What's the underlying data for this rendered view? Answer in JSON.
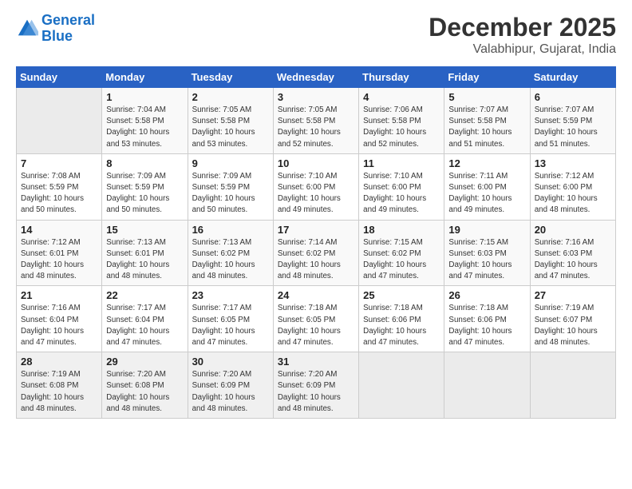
{
  "logo": {
    "text_general": "General",
    "text_blue": "Blue"
  },
  "header": {
    "month_year": "December 2025",
    "location": "Valabhipur, Gujarat, India"
  },
  "weekdays": [
    "Sunday",
    "Monday",
    "Tuesday",
    "Wednesday",
    "Thursday",
    "Friday",
    "Saturday"
  ],
  "weeks": [
    [
      {
        "day": "",
        "info": ""
      },
      {
        "day": "1",
        "info": "Sunrise: 7:04 AM\nSunset: 5:58 PM\nDaylight: 10 hours\nand 53 minutes."
      },
      {
        "day": "2",
        "info": "Sunrise: 7:05 AM\nSunset: 5:58 PM\nDaylight: 10 hours\nand 53 minutes."
      },
      {
        "day": "3",
        "info": "Sunrise: 7:05 AM\nSunset: 5:58 PM\nDaylight: 10 hours\nand 52 minutes."
      },
      {
        "day": "4",
        "info": "Sunrise: 7:06 AM\nSunset: 5:58 PM\nDaylight: 10 hours\nand 52 minutes."
      },
      {
        "day": "5",
        "info": "Sunrise: 7:07 AM\nSunset: 5:58 PM\nDaylight: 10 hours\nand 51 minutes."
      },
      {
        "day": "6",
        "info": "Sunrise: 7:07 AM\nSunset: 5:59 PM\nDaylight: 10 hours\nand 51 minutes."
      }
    ],
    [
      {
        "day": "7",
        "info": "Sunrise: 7:08 AM\nSunset: 5:59 PM\nDaylight: 10 hours\nand 50 minutes."
      },
      {
        "day": "8",
        "info": "Sunrise: 7:09 AM\nSunset: 5:59 PM\nDaylight: 10 hours\nand 50 minutes."
      },
      {
        "day": "9",
        "info": "Sunrise: 7:09 AM\nSunset: 5:59 PM\nDaylight: 10 hours\nand 50 minutes."
      },
      {
        "day": "10",
        "info": "Sunrise: 7:10 AM\nSunset: 6:00 PM\nDaylight: 10 hours\nand 49 minutes."
      },
      {
        "day": "11",
        "info": "Sunrise: 7:10 AM\nSunset: 6:00 PM\nDaylight: 10 hours\nand 49 minutes."
      },
      {
        "day": "12",
        "info": "Sunrise: 7:11 AM\nSunset: 6:00 PM\nDaylight: 10 hours\nand 49 minutes."
      },
      {
        "day": "13",
        "info": "Sunrise: 7:12 AM\nSunset: 6:00 PM\nDaylight: 10 hours\nand 48 minutes."
      }
    ],
    [
      {
        "day": "14",
        "info": "Sunrise: 7:12 AM\nSunset: 6:01 PM\nDaylight: 10 hours\nand 48 minutes."
      },
      {
        "day": "15",
        "info": "Sunrise: 7:13 AM\nSunset: 6:01 PM\nDaylight: 10 hours\nand 48 minutes."
      },
      {
        "day": "16",
        "info": "Sunrise: 7:13 AM\nSunset: 6:02 PM\nDaylight: 10 hours\nand 48 minutes."
      },
      {
        "day": "17",
        "info": "Sunrise: 7:14 AM\nSunset: 6:02 PM\nDaylight: 10 hours\nand 48 minutes."
      },
      {
        "day": "18",
        "info": "Sunrise: 7:15 AM\nSunset: 6:02 PM\nDaylight: 10 hours\nand 47 minutes."
      },
      {
        "day": "19",
        "info": "Sunrise: 7:15 AM\nSunset: 6:03 PM\nDaylight: 10 hours\nand 47 minutes."
      },
      {
        "day": "20",
        "info": "Sunrise: 7:16 AM\nSunset: 6:03 PM\nDaylight: 10 hours\nand 47 minutes."
      }
    ],
    [
      {
        "day": "21",
        "info": "Sunrise: 7:16 AM\nSunset: 6:04 PM\nDaylight: 10 hours\nand 47 minutes."
      },
      {
        "day": "22",
        "info": "Sunrise: 7:17 AM\nSunset: 6:04 PM\nDaylight: 10 hours\nand 47 minutes."
      },
      {
        "day": "23",
        "info": "Sunrise: 7:17 AM\nSunset: 6:05 PM\nDaylight: 10 hours\nand 47 minutes."
      },
      {
        "day": "24",
        "info": "Sunrise: 7:18 AM\nSunset: 6:05 PM\nDaylight: 10 hours\nand 47 minutes."
      },
      {
        "day": "25",
        "info": "Sunrise: 7:18 AM\nSunset: 6:06 PM\nDaylight: 10 hours\nand 47 minutes."
      },
      {
        "day": "26",
        "info": "Sunrise: 7:18 AM\nSunset: 6:06 PM\nDaylight: 10 hours\nand 47 minutes."
      },
      {
        "day": "27",
        "info": "Sunrise: 7:19 AM\nSunset: 6:07 PM\nDaylight: 10 hours\nand 48 minutes."
      }
    ],
    [
      {
        "day": "28",
        "info": "Sunrise: 7:19 AM\nSunset: 6:08 PM\nDaylight: 10 hours\nand 48 minutes."
      },
      {
        "day": "29",
        "info": "Sunrise: 7:20 AM\nSunset: 6:08 PM\nDaylight: 10 hours\nand 48 minutes."
      },
      {
        "day": "30",
        "info": "Sunrise: 7:20 AM\nSunset: 6:09 PM\nDaylight: 10 hours\nand 48 minutes."
      },
      {
        "day": "31",
        "info": "Sunrise: 7:20 AM\nSunset: 6:09 PM\nDaylight: 10 hours\nand 48 minutes."
      },
      {
        "day": "",
        "info": ""
      },
      {
        "day": "",
        "info": ""
      },
      {
        "day": "",
        "info": ""
      }
    ]
  ]
}
